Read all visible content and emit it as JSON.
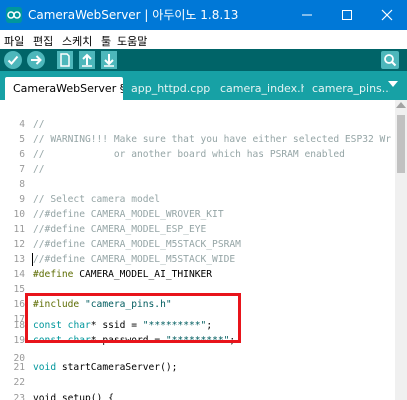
{
  "window": {
    "title": "CameraWebServer | 아두이노 1.8.13"
  },
  "menu": [
    "파일",
    "편집",
    "스케치",
    "툴",
    "도움말"
  ],
  "tabs": [
    "CameraWebServer §",
    "app_httpd.cpp",
    "camera_index.h",
    "camera_pins..."
  ],
  "editor": {
    "lines": [
      {
        "n": "4",
        "code": "//"
      },
      {
        "n": "5",
        "code": "// WARNING!!! Make sure that you have either selected ESP32 Wr"
      },
      {
        "n": "6",
        "code": "//            or another board which has PSRAM enabled"
      },
      {
        "n": "7",
        "code": "//"
      },
      {
        "n": "8",
        "code": ""
      },
      {
        "n": "9",
        "code": "// Select camera model"
      },
      {
        "n": "10",
        "code": "//#define CAMERA_MODEL_WROVER_KIT"
      },
      {
        "n": "11",
        "code": "//#define CAMERA_MODEL_ESP_EYE"
      },
      {
        "n": "12",
        "code": "//#define CAMERA_MODEL_M5STACK_PSRAM"
      },
      {
        "n": "13",
        "code": "//#define CAMERA_MODEL_M5STACK_WIDE"
      },
      {
        "n": "14",
        "kw": "#define",
        "rest": " CAMERA_MODEL_AI_THINKER"
      },
      {
        "n": "15",
        "code": ""
      },
      {
        "n": "16",
        "kw": "#include",
        "rest": " ",
        "str": "\"camera_pins.h\""
      },
      {
        "n": "17",
        "code": ""
      },
      {
        "n": "18",
        "kw": "const",
        "type": " char",
        "rest": "* ssid = ",
        "str": "\"*********\"",
        "end": ";"
      },
      {
        "n": "19",
        "kw": "const",
        "type": " char",
        "rest": "* password = ",
        "str": "\"*********\"",
        "end": ";"
      },
      {
        "n": "20",
        "code": ""
      },
      {
        "n": "21",
        "kw": "void",
        "rest": " startCameraServer();"
      },
      {
        "n": "22",
        "code": ""
      },
      {
        "n": "23",
        "code": "void setup() {"
      }
    ]
  }
}
